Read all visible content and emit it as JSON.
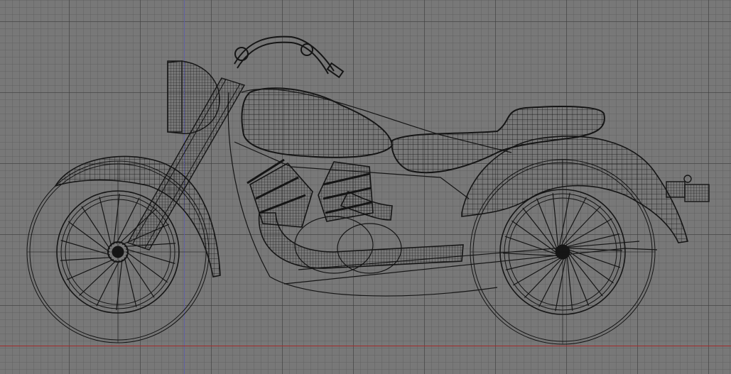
{
  "viewport": {
    "view": "side-orthographic",
    "shading": "wireframe",
    "background_color": "#787878",
    "grid_minor_color": "#5f5f5f",
    "grid_major_color": "#3c3c3c",
    "x_axis_color": "#a12a2a",
    "z_axis_color": "#5e5ea8",
    "wire_color": "#111111"
  },
  "model": {
    "subject": "motorcycle-wireframe",
    "parts": [
      "front-wheel",
      "rear-wheel",
      "front-fender",
      "rear-fender",
      "fuel-tank",
      "seat",
      "headlight",
      "handlebar",
      "front-fork",
      "engine-cylinders",
      "exhaust-pipe",
      "frame",
      "tail-light"
    ]
  }
}
